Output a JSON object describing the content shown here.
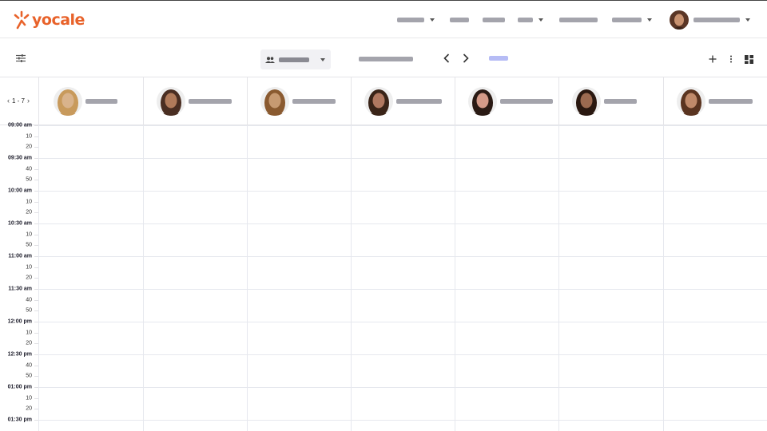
{
  "brand": {
    "logo_text": "yocale",
    "color": "#e8622a"
  },
  "nav": {
    "items": [
      {
        "key": "item1",
        "has_caret": true
      },
      {
        "key": "item2",
        "has_caret": false
      },
      {
        "key": "item3",
        "has_caret": false
      },
      {
        "key": "item4",
        "has_caret": true
      },
      {
        "key": "item5",
        "has_caret": false
      },
      {
        "key": "item6",
        "has_caret": true
      }
    ],
    "user": {
      "has_caret": true
    }
  },
  "toolbar": {
    "filter_icon": "sliders-icon",
    "team_icon": "people-icon",
    "prev_icon": "chevron-left-icon",
    "next_icon": "chevron-right-icon",
    "add_icon": "plus-icon",
    "more_icon": "more-vertical-icon",
    "view_icon": "grid-view-icon",
    "accent": "#b6bcf5"
  },
  "staff": {
    "range_label": "1 - 7",
    "members": [
      {
        "photo_color": "#d9b38c",
        "hair": "#c89a5c"
      },
      {
        "photo_color": "#b07a5a",
        "hair": "#4a2e22"
      },
      {
        "photo_color": "#c79a72",
        "hair": "#8a5a30"
      },
      {
        "photo_color": "#b07860",
        "hair": "#3a2418"
      },
      {
        "photo_color": "#d49a88",
        "hair": "#2a1a14"
      },
      {
        "photo_color": "#9c6a50",
        "hair": "#2a1810"
      },
      {
        "photo_color": "#c08a6a",
        "hair": "#5a3420"
      }
    ]
  },
  "timeline": {
    "labels": [
      {
        "text": "09:00 am",
        "major": true
      },
      {
        "text": "10",
        "major": false
      },
      {
        "text": "20",
        "major": false
      },
      {
        "text": "09:30 am",
        "major": true
      },
      {
        "text": "40",
        "major": false
      },
      {
        "text": "50",
        "major": false
      },
      {
        "text": "10:00 am",
        "major": true
      },
      {
        "text": "10",
        "major": false
      },
      {
        "text": "20",
        "major": false
      },
      {
        "text": "10:30 am",
        "major": true
      },
      {
        "text": "10",
        "major": false
      },
      {
        "text": "50",
        "major": false
      },
      {
        "text": "11:00 am",
        "major": true
      },
      {
        "text": "10",
        "major": false
      },
      {
        "text": "20",
        "major": false
      },
      {
        "text": "11:30 am",
        "major": true
      },
      {
        "text": "40",
        "major": false
      },
      {
        "text": "50",
        "major": false
      },
      {
        "text": "12:00 pm",
        "major": true
      },
      {
        "text": "10",
        "major": false
      },
      {
        "text": "20",
        "major": false
      },
      {
        "text": "12:30 pm",
        "major": true
      },
      {
        "text": "40",
        "major": false
      },
      {
        "text": "50",
        "major": false
      },
      {
        "text": "01:00 pm",
        "major": true
      },
      {
        "text": "10",
        "major": false
      },
      {
        "text": "20",
        "major": false
      },
      {
        "text": "01:30 pm",
        "major": true
      }
    ]
  }
}
